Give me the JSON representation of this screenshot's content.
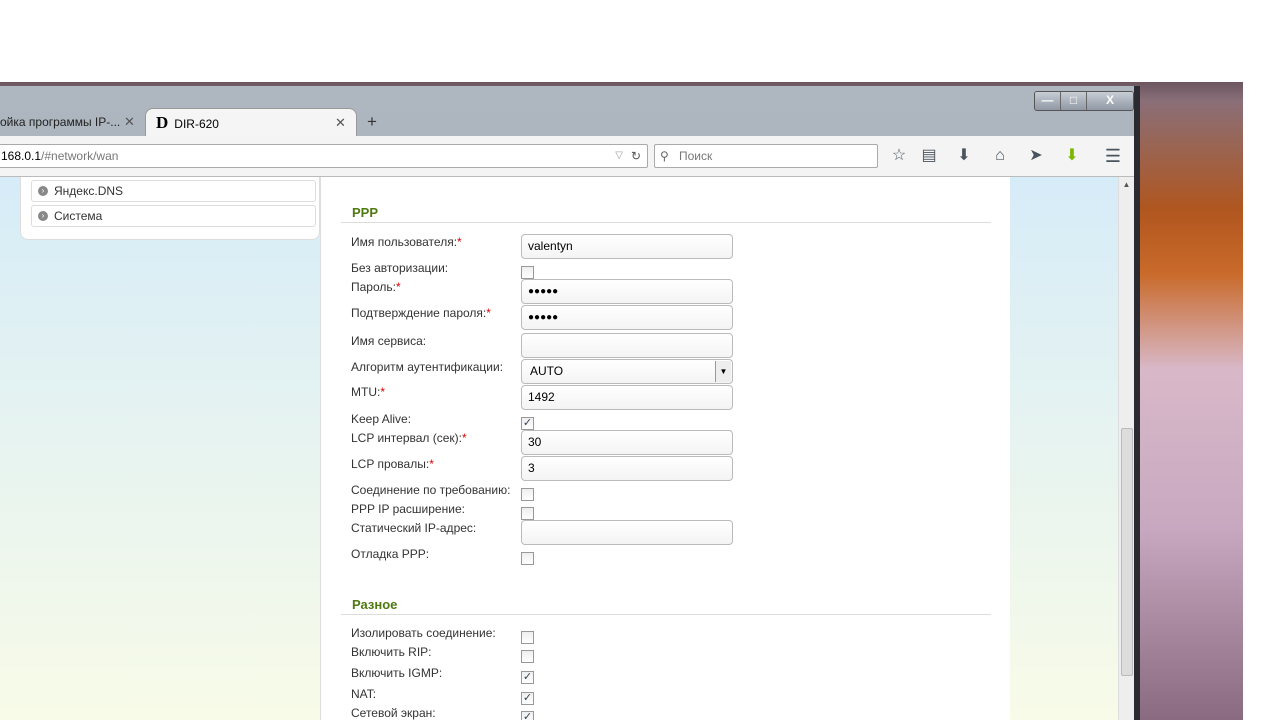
{
  "browser": {
    "tabs": [
      {
        "label": "ойка программы IP-..."
      },
      {
        "label": "DIR-620",
        "icon": "D"
      }
    ],
    "new_tab": "+",
    "url_host": "168.0.1",
    "url_path": "/#network/wan",
    "search_placeholder": "Поиск",
    "window_buttons": [
      "—",
      "□",
      "X"
    ]
  },
  "sidebar": {
    "items": [
      {
        "label": "Яндекс.DNS"
      },
      {
        "label": "Система"
      }
    ]
  },
  "ppp": {
    "title": "PPP",
    "fields": {
      "username": {
        "label": "Имя пользователя:",
        "value": "valentyn"
      },
      "noauth": {
        "label": "Без авторизации:",
        "checked": false
      },
      "password": {
        "label": "Пароль:",
        "value": "●●●●●"
      },
      "password_confirm": {
        "label": "Подтверждение пароля:",
        "value": "●●●●●"
      },
      "service": {
        "label": "Имя сервиса:",
        "value": ""
      },
      "auth": {
        "label": "Алгоритм аутентификации:",
        "value": "AUTO"
      },
      "mtu": {
        "label": "MTU:",
        "value": "1492"
      },
      "keepalive": {
        "label": "Keep Alive:",
        "checked": true
      },
      "lcp_interval": {
        "label": "LCP интервал (сек):",
        "value": "30"
      },
      "lcp_fails": {
        "label": "LCP провалы:",
        "value": "3"
      },
      "on_demand": {
        "label": "Соединение по требованию:",
        "checked": false
      },
      "ip_ext": {
        "label": "PPP IP расширение:",
        "checked": false
      },
      "static_ip": {
        "label": "Статический IP-адрес:",
        "value": ""
      },
      "debug": {
        "label": "Отладка PPP:",
        "checked": false
      }
    },
    "req": "*"
  },
  "misc": {
    "title": "Разное",
    "fields": {
      "isolate": {
        "label": "Изолировать соединение:",
        "checked": false
      },
      "rip": {
        "label": "Включить RIP:",
        "checked": false
      },
      "igmp": {
        "label": "Включить IGMP:",
        "checked": true
      },
      "nat": {
        "label": "NAT:",
        "checked": true
      },
      "firewall": {
        "label": "Сетевой экран:",
        "checked": true
      }
    }
  }
}
